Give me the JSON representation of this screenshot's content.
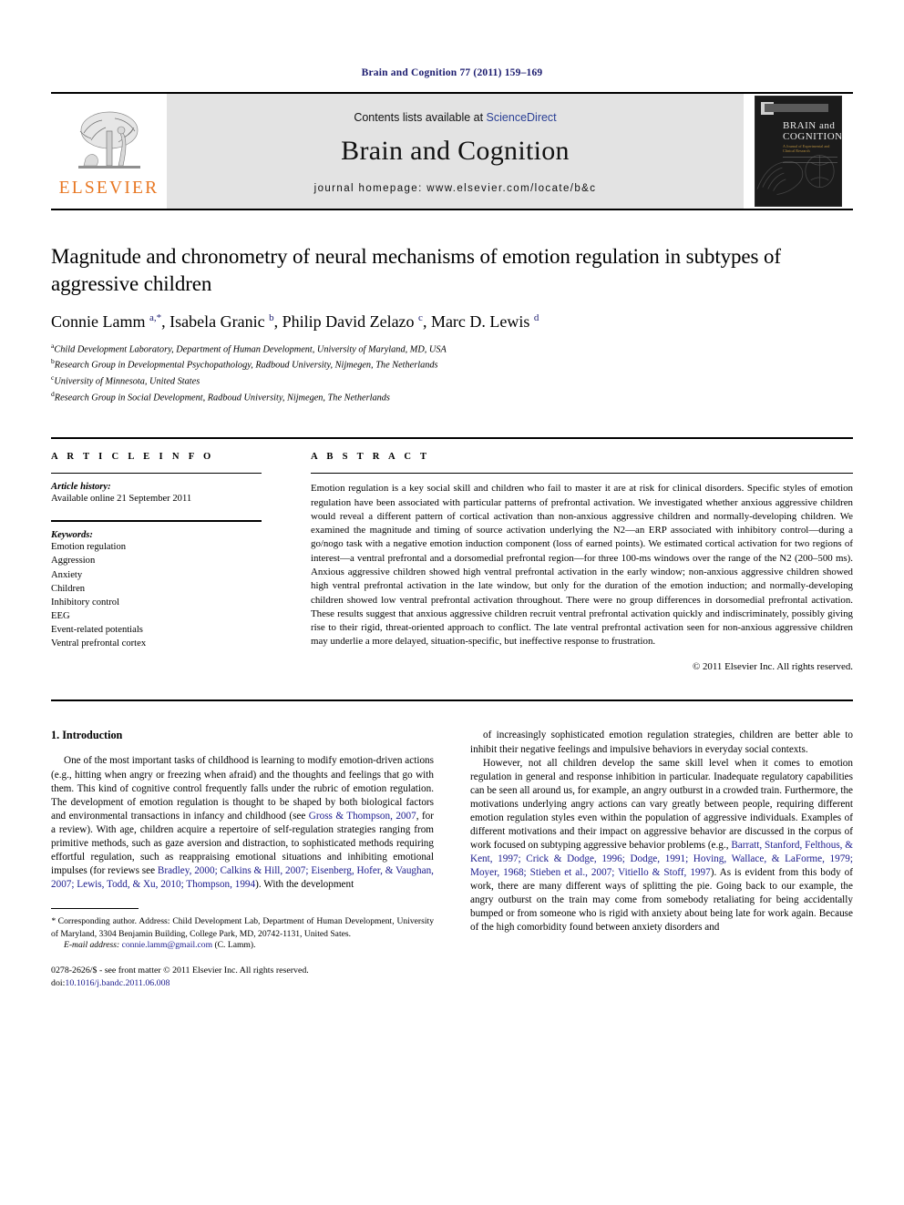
{
  "running_head": "Brain and Cognition 77 (2011) 159–169",
  "masthead": {
    "contents_prefix": "Contents lists available at ",
    "sciencedirect": "ScienceDirect",
    "journal_title": "Brain and Cognition",
    "homepage": "journal homepage: www.elsevier.com/locate/b&c",
    "publisher_wordmark": "ELSEVIER",
    "cover": {
      "line1": "BRAIN and",
      "line2": "COGNITION",
      "subtitle": "A Journal of Experimental and Clinical Research"
    },
    "accent_orange": "#E87722",
    "link_blue": "#2a3f95"
  },
  "title": "Magnitude and chronometry of neural mechanisms of emotion regulation in subtypes of aggressive children",
  "authors_html": "Connie Lamm <sup>a,*</sup>, Isabela Granic <sup>b</sup>, Philip David Zelazo <sup>c</sup>, Marc D. Lewis <sup>d</sup>",
  "affiliations": [
    {
      "marker": "a",
      "text": "Child Development Laboratory, Department of Human Development, University of Maryland, MD, USA"
    },
    {
      "marker": "b",
      "text": "Research Group in Developmental Psychopathology, Radboud University, Nijmegen, The Netherlands"
    },
    {
      "marker": "c",
      "text": "University of Minnesota, United States"
    },
    {
      "marker": "d",
      "text": "Research Group in Social Development, Radboud University, Nijmegen, The Netherlands"
    }
  ],
  "article_info": {
    "heading": "A R T I C L E   I N F O",
    "history_label": "Article history:",
    "history_value": "Available online 21 September 2011",
    "keywords_label": "Keywords:",
    "keywords": [
      "Emotion regulation",
      "Aggression",
      "Anxiety",
      "Children",
      "Inhibitory control",
      "EEG",
      "Event-related potentials",
      "Ventral prefrontal cortex"
    ]
  },
  "abstract": {
    "heading": "A B S T R A C T",
    "text": "Emotion regulation is a key social skill and children who fail to master it are at risk for clinical disorders. Specific styles of emotion regulation have been associated with particular patterns of prefrontal activation. We investigated whether anxious aggressive children would reveal a different pattern of cortical activation than non-anxious aggressive children and normally-developing children. We examined the magnitude and timing of source activation underlying the N2—an ERP associated with inhibitory control—during a go/nogo task with a negative emotion induction component (loss of earned points). We estimated cortical activation for two regions of interest—a ventral prefrontal and a dorsomedial prefrontal region—for three 100-ms windows over the range of the N2 (200–500 ms). Anxious aggressive children showed high ventral prefrontal activation in the early window; non-anxious aggressive children showed high ventral prefrontal activation in the late window, but only for the duration of the emotion induction; and normally-developing children showed low ventral prefrontal activation throughout. There were no group differences in dorsomedial prefrontal activation. These results suggest that anxious aggressive children recruit ventral prefrontal activation quickly and indiscriminately, possibly giving rise to their rigid, threat-oriented approach to conflict. The late ventral prefrontal activation seen for non-anxious aggressive children may underlie a more delayed, situation-specific, but ineffective response to frustration.",
    "copyright": "© 2011 Elsevier Inc. All rights reserved."
  },
  "section": {
    "heading": "1. Introduction"
  },
  "body": {
    "left_para_1_html": "One of the most important tasks of childhood is learning to modify emotion-driven actions (e.g., hitting when angry or freezing when afraid) and the thoughts and feelings that go with them. This kind of cognitive control frequently falls under the rubric of emotion regulation. The development of emotion regulation is thought to be shaped by both biological factors and environmental transactions in infancy and childhood (see <span class=\"cit\">Gross &amp; Thompson, 2007</span>, for a review). With age, children acquire a repertoire of self-regulation strategies ranging from primitive methods, such as gaze aversion and distraction, to sophisticated methods requiring effortful regulation, such as reappraising emotional situations and inhibiting emotional impulses (for reviews see <span class=\"cit\">Bradley, 2000; Calkins &amp; Hill, 2007; Eisenberg, Hofer, &amp; Vaughan, 2007; Lewis, Todd, &amp; Xu, 2010; Thompson, 1994</span>). With the development",
    "right_para_1_html": "of increasingly sophisticated emotion regulation strategies, children are better able to inhibit their negative feelings and impulsive behaviors in everyday social contexts.",
    "right_para_2_html": "However, not all children develop the same skill level when it comes to emotion regulation in general and response inhibition in particular. Inadequate regulatory capabilities can be seen all around us, for example, an angry outburst in a crowded train. Furthermore, the motivations underlying angry actions can vary greatly between people, requiring different emotion regulation styles even within the population of aggressive individuals. Examples of different motivations and their impact on aggressive behavior are discussed in the corpus of work focused on subtyping aggressive behavior problems (e.g., <span class=\"cit\">Barratt, Stanford, Felthous, &amp; Kent, 1997; Crick &amp; Dodge, 1996; Dodge, 1991; Hoving, Wallace, &amp; LaForme, 1979; Moyer, 1968; Stieben et al., 2007; Vitiello &amp; Stoff, 1997</span>). As is evident from this body of work, there are many different ways of splitting the pie. Going back to our example, the angry outburst on the train may come from somebody retaliating for being accidentally bumped or from someone who is rigid with anxiety about being late for work again. Because of the high comorbidity found between anxiety disorders and"
  },
  "footnote": {
    "corresponding_html": "<span class=\"lbl\">*</span> Corresponding author. Address: Child Development Lab, Department of Human Development, University of Maryland, 3304 Benjamin Building, College Park, MD, 20742-1131, United Sates.",
    "email_label": "E-mail address:",
    "email": "connie.lamm@gmail.com",
    "email_attrib": "(C. Lamm)."
  },
  "imprint": {
    "line1": "0278-2626/$ - see front matter © 2011 Elsevier Inc. All rights reserved.",
    "doi_label": "doi:",
    "doi": "10.1016/j.bandc.2011.06.008"
  }
}
